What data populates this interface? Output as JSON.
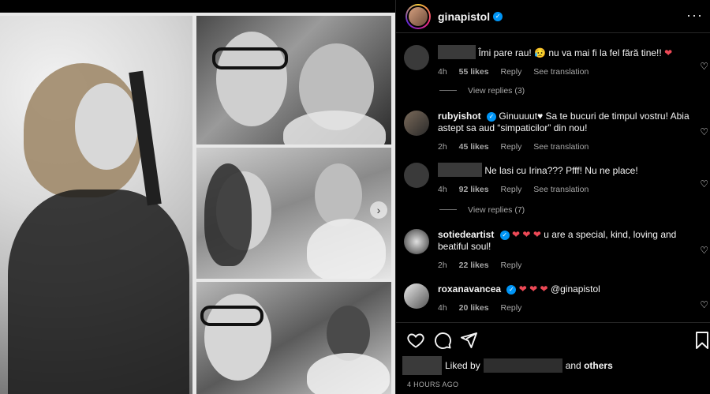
{
  "post": {
    "author": "ginapistol",
    "more_icon": "ellipsis-icon",
    "time_ago": "4 HOURS AGO"
  },
  "comments": [
    {
      "user": "",
      "text": "Îmi pare rau! 😥 nu va mai fi la fel fără tine!!",
      "emoji_tail": "❤",
      "time": "4h",
      "likes": "55 likes",
      "reply": "Reply",
      "translation": "See translation",
      "replies": "View replies (3)"
    },
    {
      "user": "rubyishot",
      "text": "Ginuuuut♥ Sa te bucuri de timpul vostru! Abia astept sa aud “simpaticilor” din nou!",
      "time": "2h",
      "likes": "45 likes",
      "reply": "Reply",
      "translation": "See translation"
    },
    {
      "user": "",
      "text": "Ne lasi cu Irina??? Pfff! Nu ne place!",
      "time": "4h",
      "likes": "92 likes",
      "reply": "Reply",
      "translation": "See translation",
      "replies": "View replies (7)"
    },
    {
      "user": "sotiedeartist",
      "hearts": "❤ ❤ ❤",
      "text": "u are a special, kind, loving and beatiful soul!",
      "time": "2h",
      "likes": "22 likes",
      "reply": "Reply"
    },
    {
      "user": "roxanavancea",
      "hearts": "❤ ❤ ❤",
      "text": "@ginapistol",
      "time": "4h",
      "likes": "20 likes",
      "reply": "Reply"
    }
  ],
  "footer": {
    "liked_prefix": "Liked by",
    "liked_suffix_and": "and",
    "liked_others": "others"
  },
  "icons": {
    "like": "heart-icon",
    "comment": "comment-icon",
    "share": "share-icon",
    "save": "bookmark-icon"
  },
  "colors": {
    "accent_red": "#ed4956",
    "verified_blue": "#0095f6",
    "muted_text": "#a8a8a8"
  }
}
